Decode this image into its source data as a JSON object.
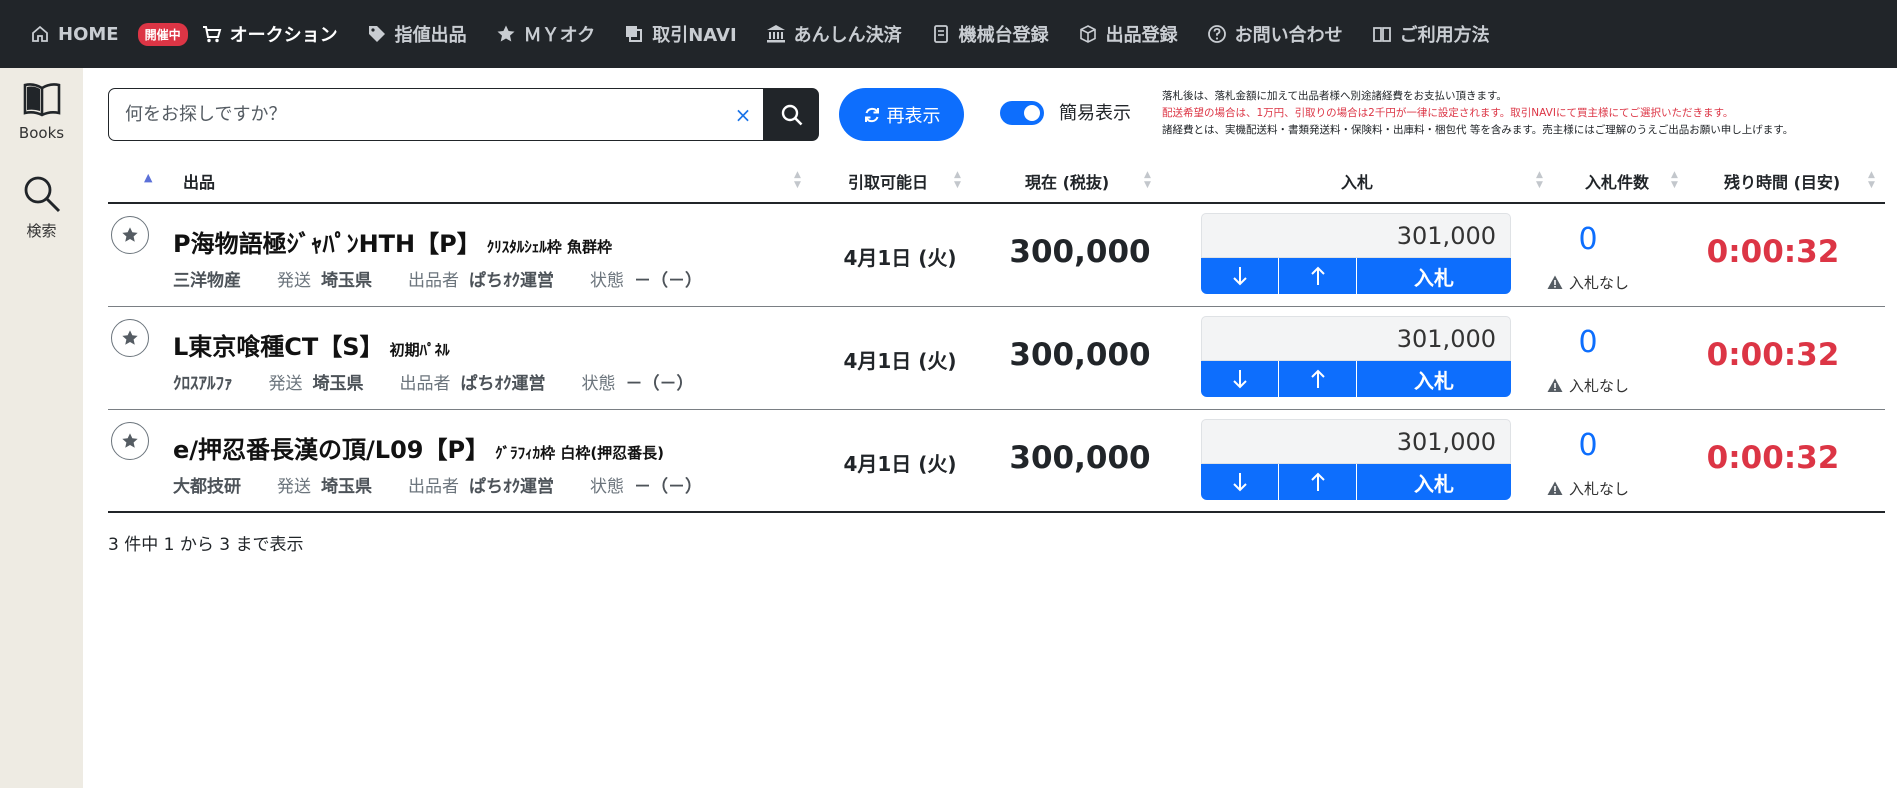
{
  "nav": {
    "items": [
      {
        "label": "HOME",
        "icon": "home-icon"
      },
      {
        "label": "オークション",
        "icon": "cart-icon",
        "badge": "開催中"
      },
      {
        "label": "指値出品",
        "icon": "tag-icon"
      },
      {
        "label": "ＭＹオク",
        "icon": "star-icon"
      },
      {
        "label": "取引NAVI",
        "icon": "copy-icon"
      },
      {
        "label": "あんしん決済",
        "icon": "bank-icon"
      },
      {
        "label": "機械台登録",
        "icon": "document-icon"
      },
      {
        "label": "出品登録",
        "icon": "box-icon"
      },
      {
        "label": "お問い合わせ",
        "icon": "question-icon"
      },
      {
        "label": "ご利用方法",
        "icon": "book-open-icon"
      }
    ]
  },
  "sidebar": {
    "items": [
      {
        "label": "Books",
        "icon": "book-icon"
      },
      {
        "label": "検索",
        "icon": "search-icon"
      }
    ]
  },
  "search": {
    "placeholder": "何をお探しですか？",
    "clear_label": "×"
  },
  "refresh_label": "再表示",
  "toggle_label": "簡易表示",
  "notice": {
    "line1": "落札後は、落札金額に加えて出品者様へ別途諸経費をお支払い頂きます。",
    "line2": "配送希望の場合は、1万円、引取りの場合は2千円が一律に設定されます。取引NAVIにて買主様にてご選択いただきます。",
    "line3": "諸経費とは、実機配送料・書類発送料・保険料・出庫料・梱包代 等を含みます。売主様にはご理解のうえご出品お願い申し上げます。"
  },
  "columns": {
    "item": "出品",
    "pickup": "引取可能日",
    "price": "現在 (税抜)",
    "bid": "入札",
    "bid_count": "入札件数",
    "time_left": "残り時間 (目安)"
  },
  "rows": [
    {
      "title": "P海物語極ｼﾞｬﾊﾟﾝHTH【P】",
      "subtitle": "ｸﾘｽﾀﾙｼｪﾙ枠 魚群枠",
      "maker": "三洋物産",
      "ship_label": "発送",
      "ship_value": "埼玉県",
      "seller_label": "出品者",
      "seller_value": "ぱちｵｸ運営",
      "condition_label": "状態",
      "condition_value": "－（－）",
      "pickup": "4月1日 (火)",
      "price": "300,000",
      "bid_value": "301,000",
      "bid_button": "入札",
      "bid_count": "0",
      "no_bid": "入札なし",
      "time_left": "0:00:32"
    },
    {
      "title": "L東京喰種CT【S】",
      "subtitle": "初期ﾊﾟﾈﾙ",
      "maker": "ｸﾛｽｱﾙﾌｧ",
      "ship_label": "発送",
      "ship_value": "埼玉県",
      "seller_label": "出品者",
      "seller_value": "ぱちｵｸ運営",
      "condition_label": "状態",
      "condition_value": "－（－）",
      "pickup": "4月1日 (火)",
      "price": "300,000",
      "bid_value": "301,000",
      "bid_button": "入札",
      "bid_count": "0",
      "no_bid": "入札なし",
      "time_left": "0:00:32"
    },
    {
      "title": "e/押忍番長漢の頂/L09【P】",
      "subtitle": "ｸﾞﾗﾌｨｶ枠 白枠(押忍番長)",
      "maker": "大都技研",
      "ship_label": "発送",
      "ship_value": "埼玉県",
      "seller_label": "出品者",
      "seller_value": "ぱちｵｸ運営",
      "condition_label": "状態",
      "condition_value": "－（－）",
      "pickup": "4月1日 (火)",
      "price": "300,000",
      "bid_value": "301,000",
      "bid_button": "入札",
      "bid_count": "0",
      "no_bid": "入札なし",
      "time_left": "0:00:32"
    }
  ],
  "footer_info": "3 件中 1 から 3 まで表示",
  "colors": {
    "nav_bg": "#212529",
    "accent": "#0d6efd",
    "danger": "#dc3545",
    "sidebar_bg": "#eeebe3"
  }
}
